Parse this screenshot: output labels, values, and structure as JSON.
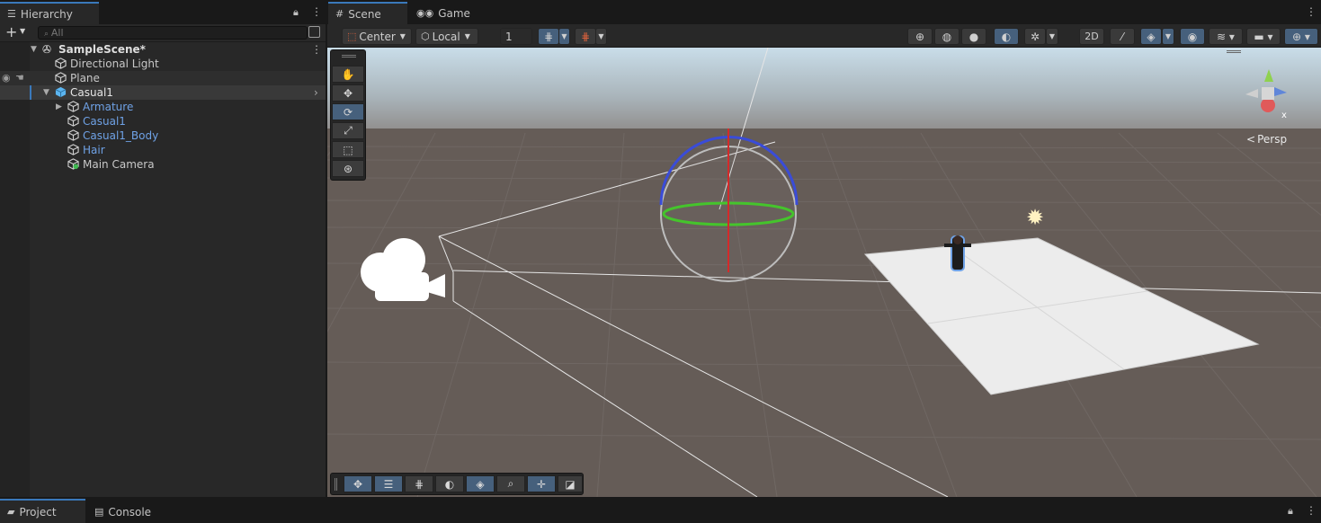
{
  "hierarchy": {
    "tab_label": "Hierarchy",
    "search_placeholder": "All",
    "add_label": "+",
    "scene_name": "SampleScene*",
    "items": [
      {
        "label": "Directional Light"
      },
      {
        "label": "Plane"
      },
      {
        "label": "Casual1"
      },
      {
        "label": "Armature"
      },
      {
        "label": "Casual1"
      },
      {
        "label": "Casual1_Body"
      },
      {
        "label": "Hair"
      },
      {
        "label": "Main Camera"
      }
    ]
  },
  "tabs": {
    "scene": "Scene",
    "game": "Game",
    "project": "Project",
    "console": "Console"
  },
  "scene_toolbar": {
    "pivot_label": "Center",
    "space_label": "Local",
    "snap_value": "1"
  },
  "scene_view": {
    "persp_label": "Persp",
    "gizmo_x_label": "x"
  },
  "colors": {
    "accent": "#3a79bb",
    "prefab_text": "#6fa2e6",
    "panel_bg": "#282828",
    "active_button": "#46607c"
  },
  "icons": [
    "hand-icon",
    "move-icon",
    "rotate-icon",
    "scale-icon",
    "rect-icon",
    "transform-icon",
    "lock-icon",
    "kebab-icon",
    "eye-icon",
    "camera-icon",
    "sun-icon"
  ]
}
